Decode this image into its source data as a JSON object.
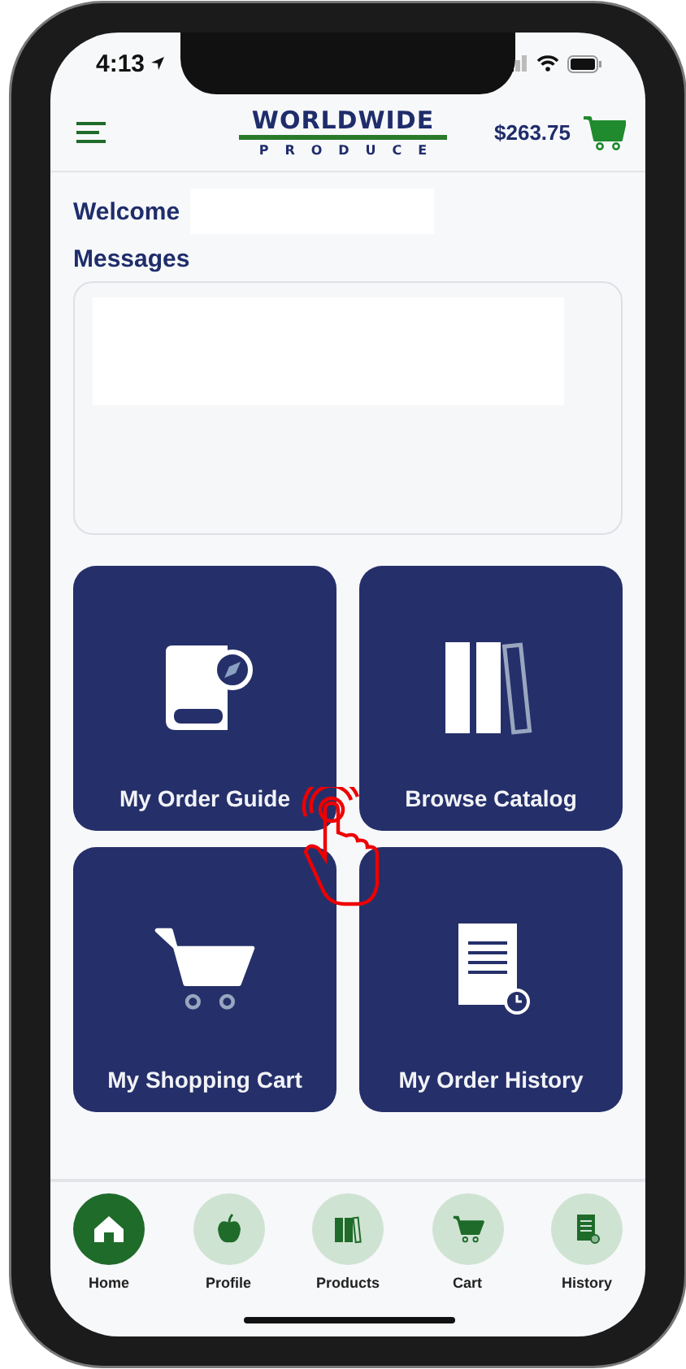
{
  "status_bar": {
    "time": "4:13"
  },
  "header": {
    "logo_top": "WORLDWIDE",
    "logo_bottom": "PRODUCE",
    "cart_total": "$263.75"
  },
  "welcome": {
    "label": "Welcome"
  },
  "messages": {
    "title": "Messages"
  },
  "tiles": [
    {
      "kind": "guide",
      "label": "My Order Guide"
    },
    {
      "kind": "catalog",
      "label": "Browse Catalog"
    },
    {
      "kind": "cart",
      "label": "My Shopping Cart"
    },
    {
      "kind": "history",
      "label": "My Order History"
    }
  ],
  "nav": [
    {
      "kind": "home",
      "label": "Home",
      "selected": true
    },
    {
      "kind": "profile",
      "label": "Profile",
      "selected": false
    },
    {
      "kind": "products",
      "label": "Products",
      "selected": false
    },
    {
      "kind": "cart",
      "label": "Cart",
      "selected": false
    },
    {
      "kind": "history",
      "label": "History",
      "selected": false
    }
  ]
}
